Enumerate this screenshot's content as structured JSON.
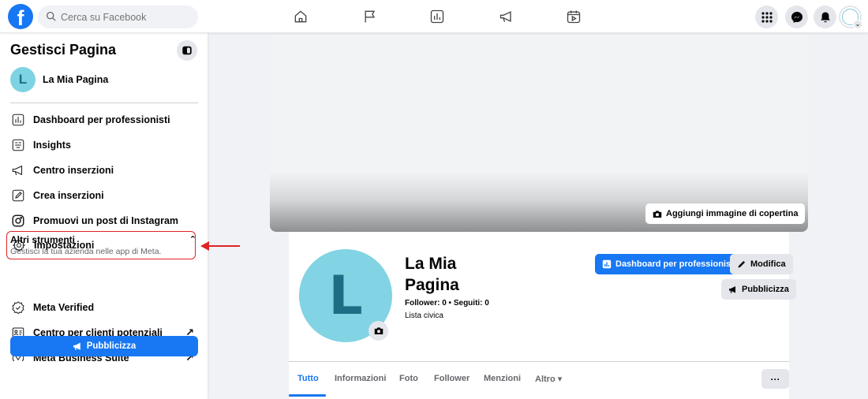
{
  "topbar": {
    "logo": "f",
    "search_placeholder": "Cerca su Facebook",
    "nav_icons": [
      "home-icon",
      "flag-icon",
      "dashboard-icon",
      "megaphone-icon",
      "calendar-video-icon"
    ],
    "right_icons": [
      "apps-grid-icon",
      "messenger-icon",
      "bell-icon",
      "account-avatar"
    ]
  },
  "sidebar": {
    "title": "Gestisci Pagina",
    "page_avatar_letter": "L",
    "page_name": "La Mia Pagina",
    "items": [
      {
        "label": "Dashboard per professionisti",
        "icon": "dashboard-icon"
      },
      {
        "label": "Insights",
        "icon": "insights-icon"
      },
      {
        "label": "Centro inserzioni",
        "icon": "megaphone-icon"
      },
      {
        "label": "Crea inserzioni",
        "icon": "pencil-icon"
      },
      {
        "label": "Promuovi un post di Instagram",
        "icon": "instagram-icon"
      },
      {
        "label": "Impostazioni",
        "icon": "gear-icon"
      }
    ],
    "section": {
      "title": "Altri strumenti",
      "subtitle": "Gestisci la tua azienda nelle app di Meta."
    },
    "section_items": [
      {
        "label": "Meta Verified",
        "icon": "verified-badge-icon",
        "external": ""
      },
      {
        "label": "Centro per clienti potenziali",
        "icon": "contacts-icon",
        "external": "↗"
      },
      {
        "label": "Meta Business Suite",
        "icon": "meta-business-icon",
        "external": "↗"
      }
    ],
    "publish_label": "Pubblicizza"
  },
  "cover": {
    "add_cover_label": "Aggiungi immagine di copertina"
  },
  "profile": {
    "avatar_letter": "L",
    "name_line1": "La Mia",
    "name_line2": "Pagina",
    "stats": "Follower: 0 • Seguiti: 0",
    "category": "Lista civica",
    "dashboard_button": "Dashboard per professionisti",
    "edit_button": "Modifica",
    "publish_button": "Pubblicizza"
  },
  "tabs": [
    {
      "label": "Tutto",
      "active": true
    },
    {
      "label": "Informazioni"
    },
    {
      "label": "Foto"
    },
    {
      "label": "Follower"
    },
    {
      "label": "Menzioni"
    },
    {
      "label": "Altro ▾"
    }
  ],
  "more_button": "···",
  "colors": {
    "accent": "#1877f2",
    "highlight": "#e02424",
    "avatar_bg": "#82d3e3"
  }
}
